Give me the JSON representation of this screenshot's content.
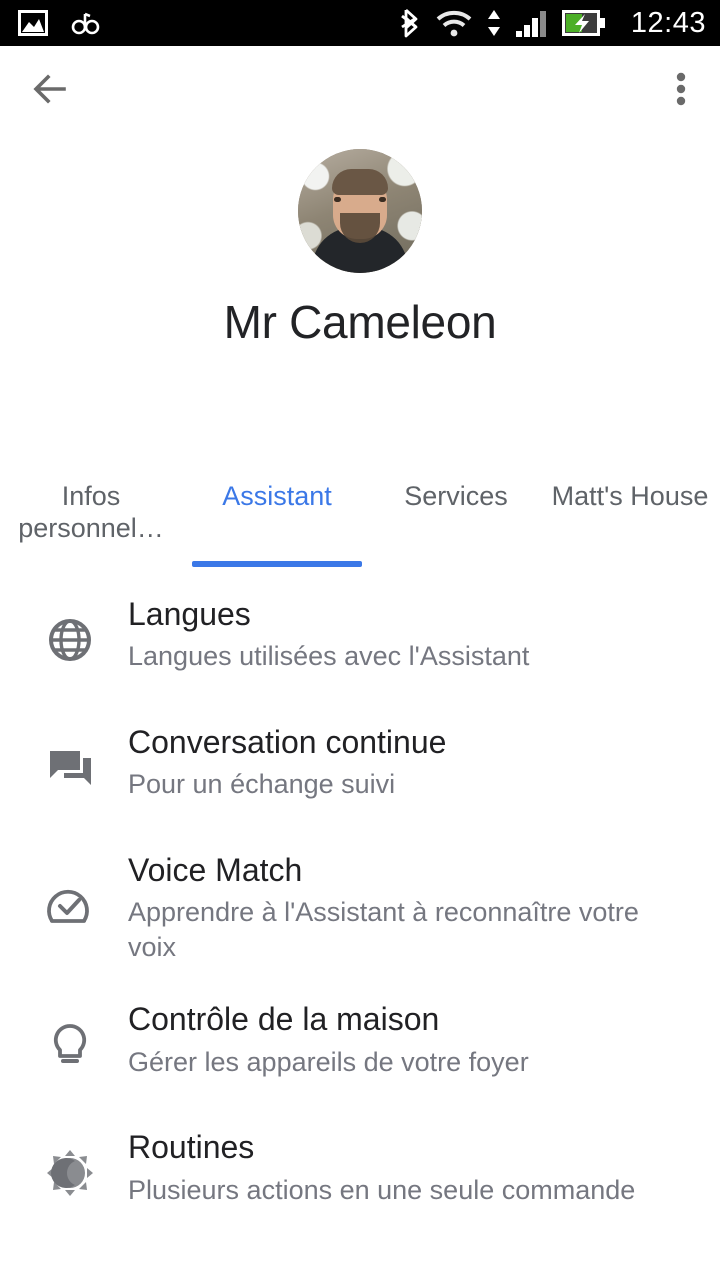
{
  "statusbar": {
    "time": "12:43",
    "left_icons": [
      "photo-icon",
      "glasses-icon"
    ],
    "right_icons": [
      "bluetooth-icon",
      "wifi-icon",
      "data-transfer-icon",
      "cellular-signal-icon",
      "battery-charging-icon"
    ],
    "background": "#000000",
    "foreground": "#ffffff",
    "battery_fill": "#4caf27"
  },
  "appbar": {
    "back_icon": "arrow-back-icon",
    "overflow_icon": "more-vertical-icon",
    "icon_color": "#6a6a6a"
  },
  "profile": {
    "name": "Mr Cameleon",
    "avatar_alt": "profile-photo"
  },
  "tabs": {
    "active_color": "#3b78e7",
    "inactive_color": "#5f6368",
    "items": [
      {
        "label": "Infos personnel…",
        "active": false
      },
      {
        "label": "Assistant",
        "active": true
      },
      {
        "label": "Services",
        "active": false
      },
      {
        "label": "Matt's House",
        "active": false
      }
    ]
  },
  "list": {
    "items": [
      {
        "icon": "globe-icon",
        "title": "Langues",
        "subtitle": "Langues utilisées avec l'Assistant"
      },
      {
        "icon": "forum-icon",
        "title": "Conversation continue",
        "subtitle": "Pour un échange suivi"
      },
      {
        "icon": "voice-match-icon",
        "title": "Voice Match",
        "subtitle": "Apprendre à l'Assistant à reconnaître votre voix"
      },
      {
        "icon": "lightbulb-icon",
        "title": "Contrôle de la maison",
        "subtitle": "Gérer les appareils de votre foyer"
      },
      {
        "icon": "routines-icon",
        "title": "Routines",
        "subtitle": "Plusieurs actions en une seule commande"
      }
    ]
  }
}
